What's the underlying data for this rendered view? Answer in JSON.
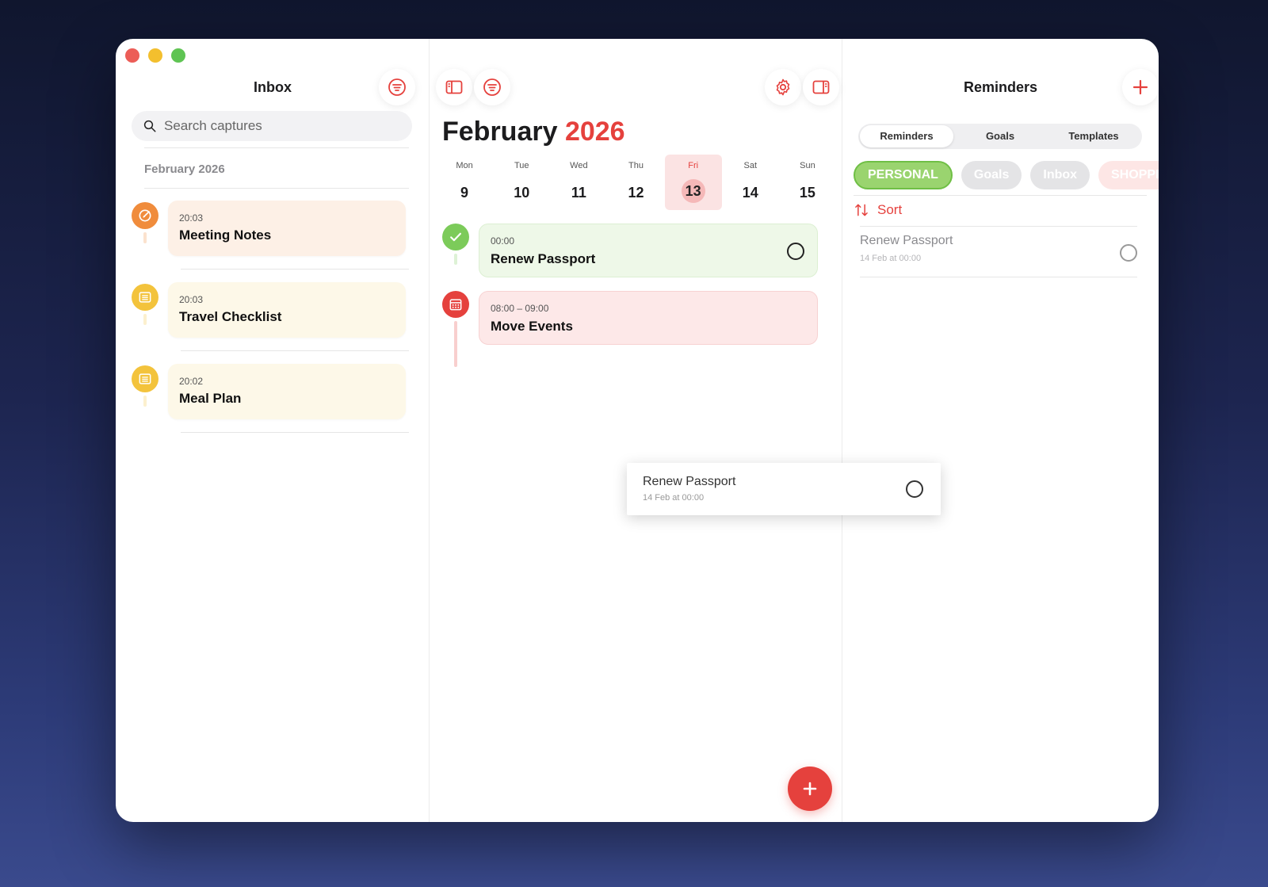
{
  "inbox": {
    "title": "Inbox",
    "search_placeholder": "Search captures",
    "section_label": "February 2026",
    "captures": [
      {
        "time": "20:03",
        "name": "Meeting Notes",
        "icon": "note-pencil-icon",
        "accent": "#f08c3c",
        "card_bg": "#fdf0e6"
      },
      {
        "time": "20:03",
        "name": "Travel Checklist",
        "icon": "list-icon",
        "accent": "#f3c33c",
        "card_bg": "#fdf8e8"
      },
      {
        "time": "20:02",
        "name": "Meal Plan",
        "icon": "list-icon",
        "accent": "#f3c33c",
        "card_bg": "#fdf8e8"
      }
    ]
  },
  "calendar": {
    "month": "February",
    "year": "2026",
    "week": [
      {
        "dow": "Mon",
        "date": "9"
      },
      {
        "dow": "Tue",
        "date": "10"
      },
      {
        "dow": "Wed",
        "date": "11"
      },
      {
        "dow": "Thu",
        "date": "12"
      },
      {
        "dow": "Fri",
        "date": "13",
        "selected": true
      },
      {
        "dow": "Sat",
        "date": "14"
      },
      {
        "dow": "Sun",
        "date": "15"
      }
    ],
    "events": [
      {
        "time": "00:00",
        "name": "Renew Passport",
        "kind": "reminder",
        "accent": "#7ccb5a",
        "card_bg": "#eef8e8"
      },
      {
        "time": "08:00 – 09:00",
        "name": "Move Events",
        "kind": "event",
        "accent": "#e5413d",
        "card_bg": "#fde8e8"
      }
    ]
  },
  "reminders": {
    "title": "Reminders",
    "tabs": [
      "Reminders",
      "Goals",
      "Templates"
    ],
    "active_tab": "Reminders",
    "lists": [
      "PERSONAL",
      "Goals",
      "Inbox",
      "SHOPPI"
    ],
    "sort_label": "Sort",
    "items": [
      {
        "title": "Renew Passport",
        "subtitle": "14 Feb at 00:00"
      }
    ]
  },
  "drag_preview": {
    "title": "Renew Passport",
    "subtitle": "14 Feb at 00:00"
  },
  "colors": {
    "accent": "#e5413d",
    "green": "#7ccb5a",
    "orange": "#f08c3c",
    "yellow": "#f3c33c"
  }
}
